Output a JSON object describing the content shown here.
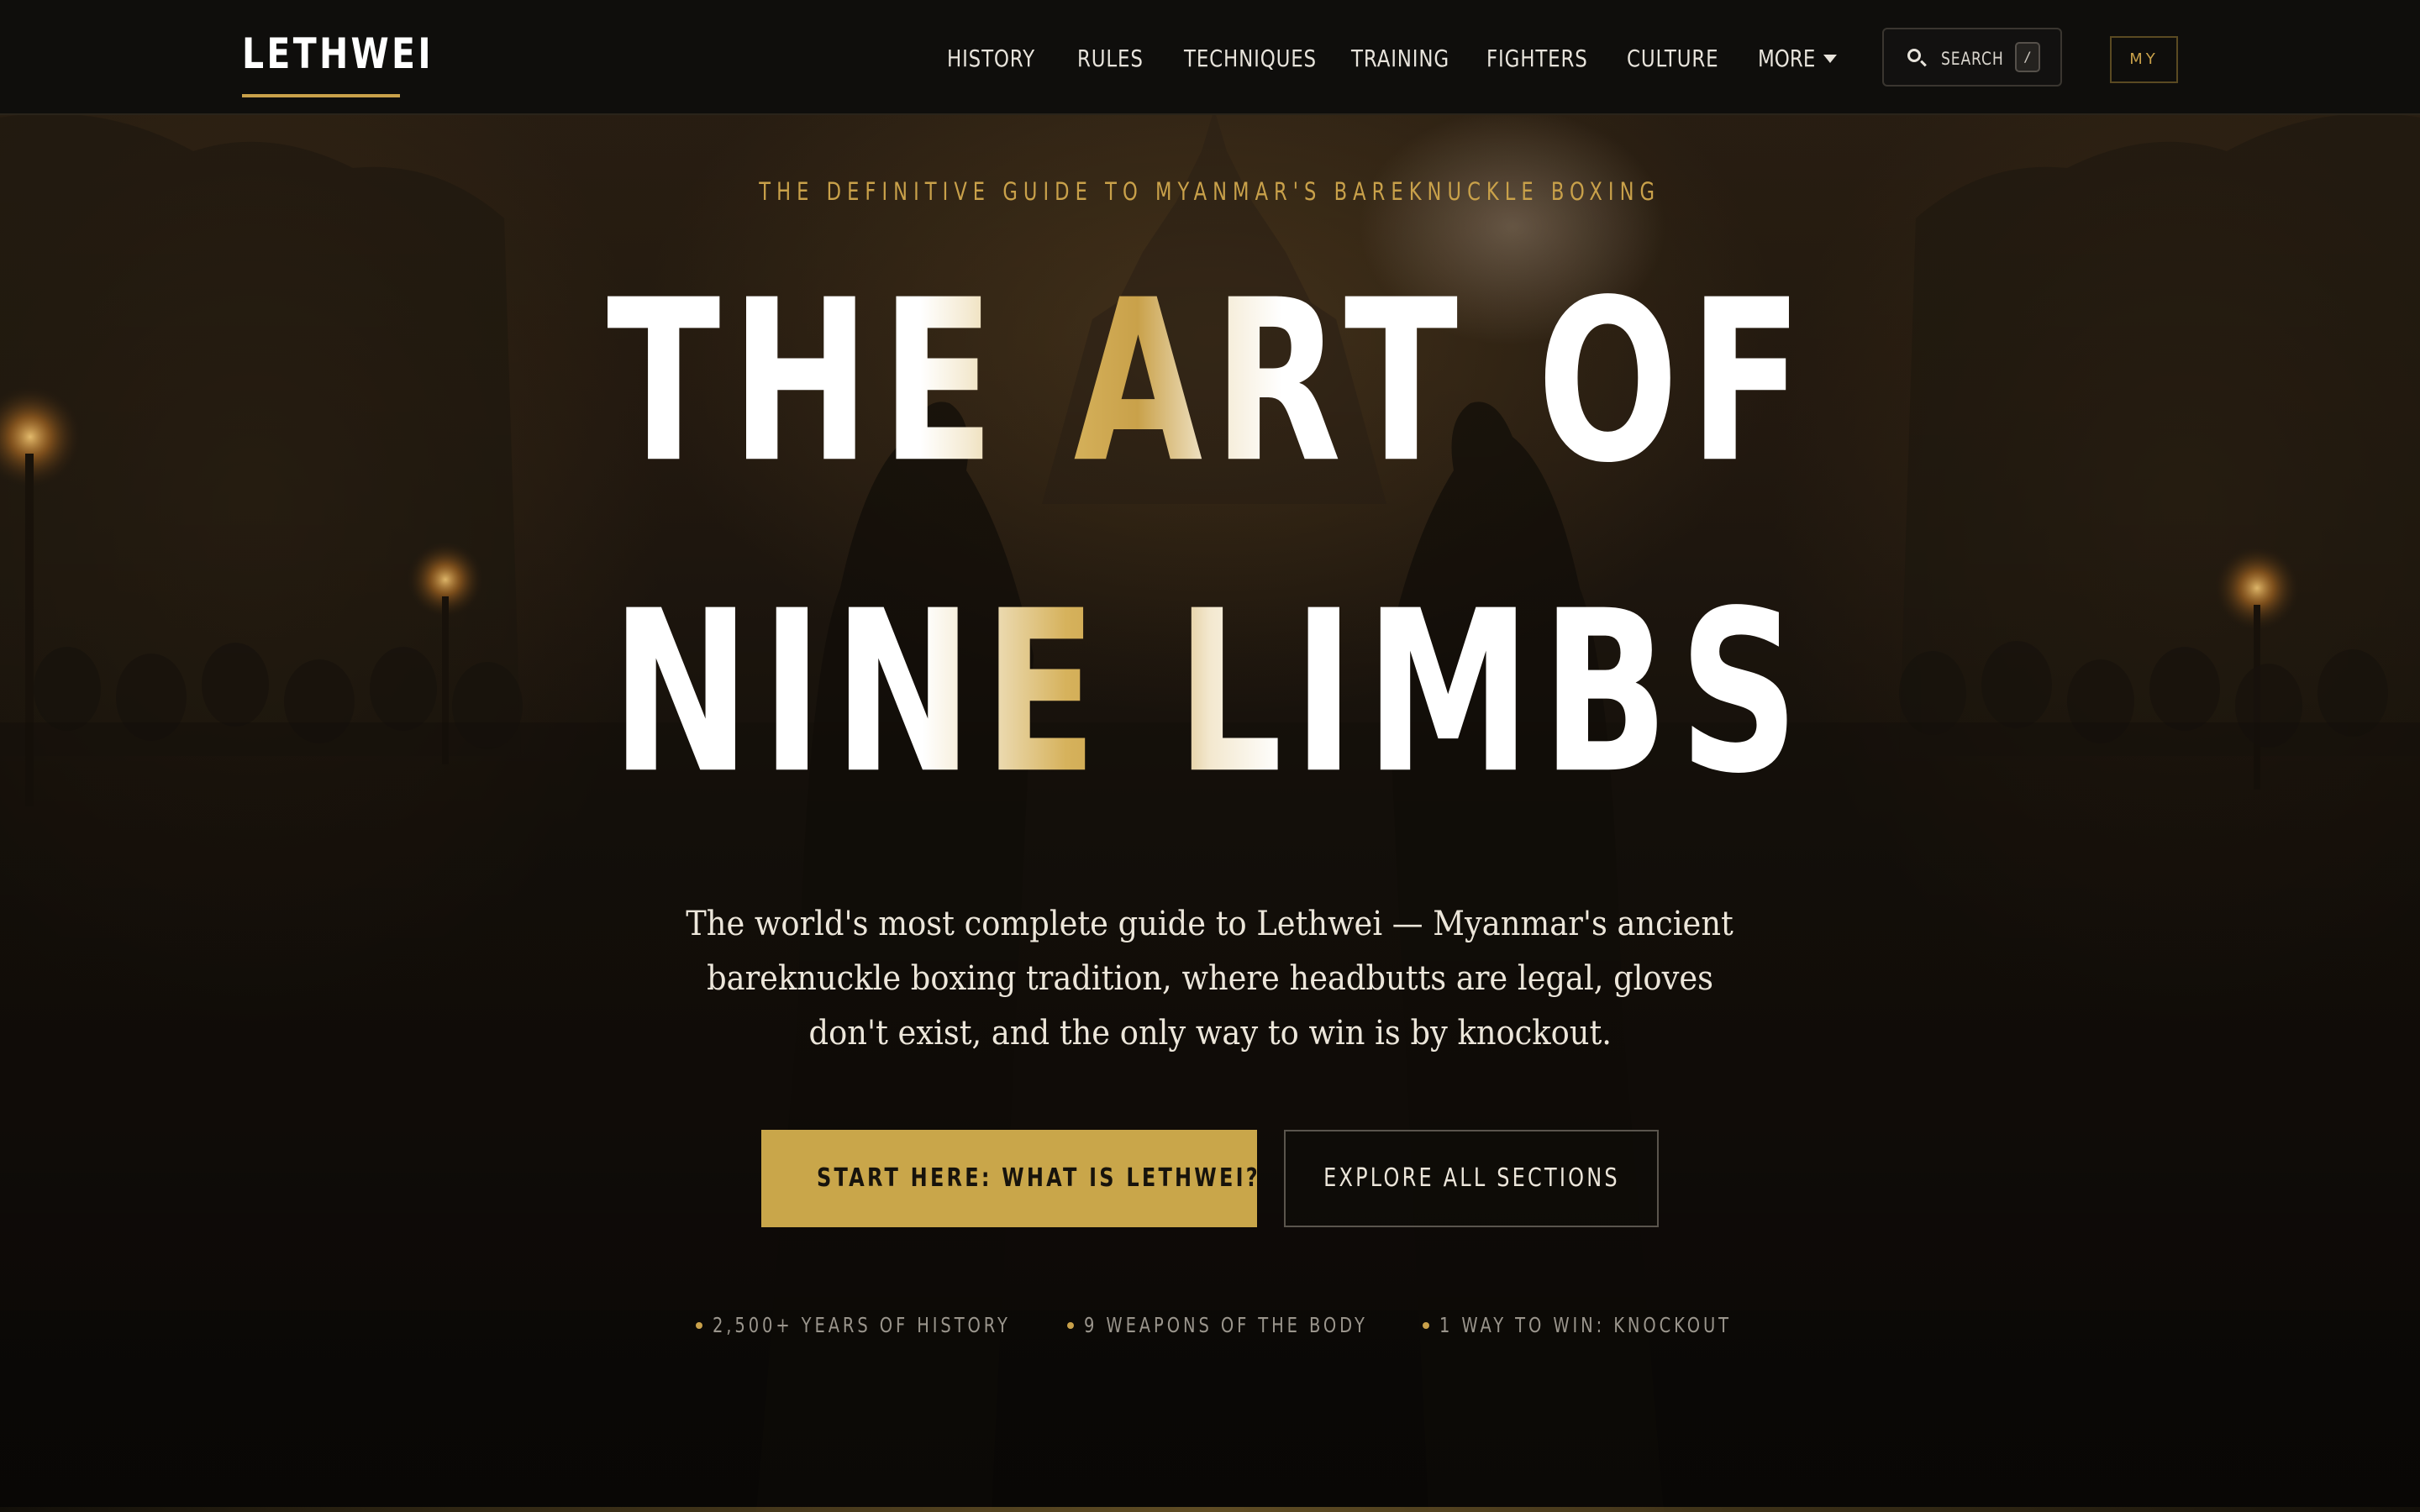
{
  "nav": {
    "logo": "LETHWEI",
    "links": [
      "HISTORY",
      "RULES",
      "TECHNIQUES",
      "TRAINING",
      "FIGHTERS",
      "CULTURE"
    ],
    "more_label": "MORE",
    "search_label": "SEARCH",
    "search_shortcut": "/",
    "language_label": "MY"
  },
  "hero": {
    "eyebrow": "THE DEFINITIVE GUIDE TO MYANMAR'S BAREKNUCKLE BOXING",
    "headline_line_1": "THE ART OF",
    "headline_line_2": "NINE LIMBS",
    "intro_line_1": "The world's most complete guide to Lethwei — Myanmar's ancient",
    "intro_line_2": "bareknuckle boxing tradition, where headbutts are legal, gloves",
    "intro_line_3": "don't exist, and the only way to win is by knockout.",
    "primary_cta": "START HERE: WHAT IS LETHWEI?",
    "secondary_cta": "EXPLORE ALL SECTIONS",
    "stats": [
      "2,500+ YEARS OF HISTORY",
      "9 WEAPONS OF THE BODY",
      "1 WAY TO WIN: KNOCKOUT"
    ]
  },
  "colors": {
    "accent_gold": "#c9a14a",
    "background": "#0f0d0a",
    "nav_background": "#0f0e0c",
    "text_primary": "#ffffff"
  },
  "icons": {
    "search": "search-icon",
    "more": "caret-down-icon"
  }
}
